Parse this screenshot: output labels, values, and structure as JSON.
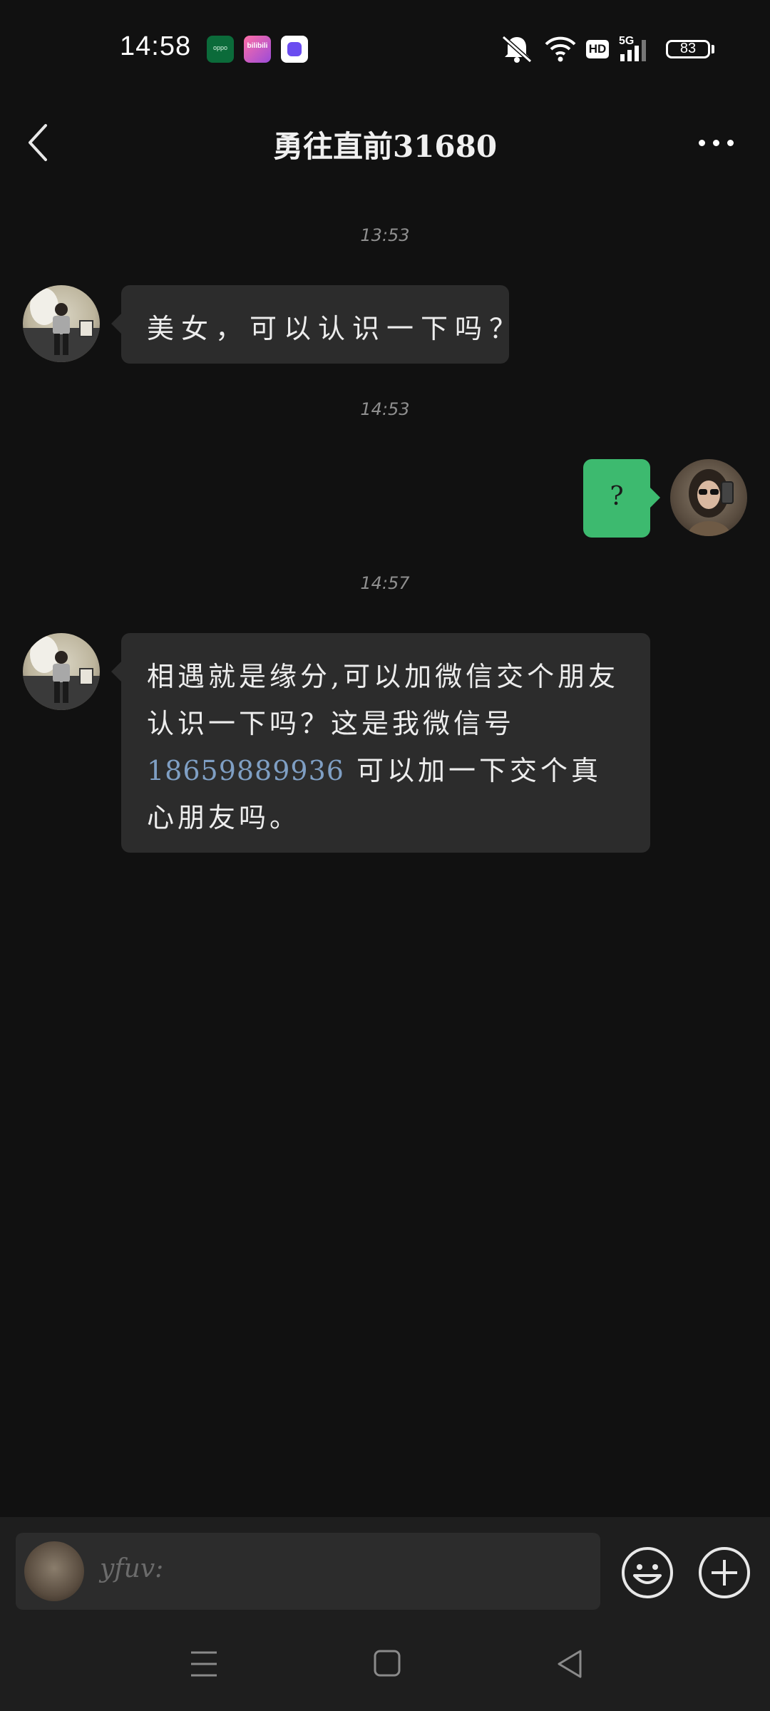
{
  "status_bar": {
    "time": "14:58",
    "apps": [
      {
        "name": "oppo-app",
        "label": "oppo"
      },
      {
        "name": "bilibili-app",
        "label": "bilibili"
      },
      {
        "name": "purple-app",
        "label": ""
      }
    ],
    "network_badge": "HD",
    "network_type": "5G",
    "battery": "83"
  },
  "header": {
    "title": "勇往直前31680"
  },
  "messages": [
    {
      "timestamp": "13:53",
      "sender": "contact",
      "text": "美女，可以认识一下吗？"
    },
    {
      "timestamp": "14:53",
      "sender": "me",
      "text": "?"
    },
    {
      "timestamp": "14:57",
      "sender": "contact",
      "text_before": "相遇就是缘分,可以加微信交个朋友认识一下吗？这是我微信号",
      "link": "18659889936",
      "text_after": " 可以加一下交个真心朋友吗。"
    }
  ],
  "input": {
    "placeholder": "yfuv:"
  },
  "colors": {
    "background": "#111111",
    "incoming_bubble": "#2c2c2c",
    "outgoing_bubble": "#3dba6f",
    "link": "#7f9fc4"
  }
}
